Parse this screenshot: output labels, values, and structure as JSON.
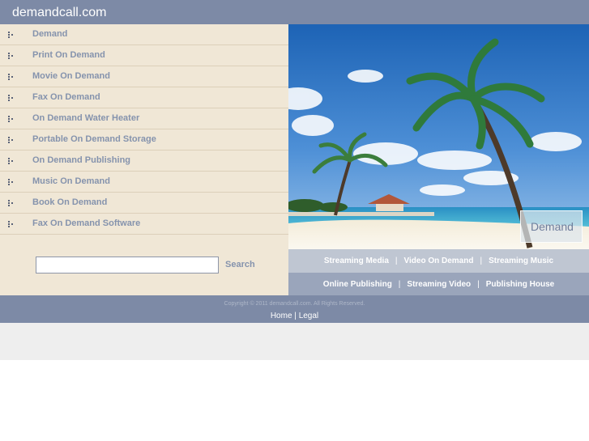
{
  "header": {
    "site_title": "demandcall.com"
  },
  "sidebar": {
    "items": [
      {
        "label": "Demand"
      },
      {
        "label": "Print On Demand"
      },
      {
        "label": "Movie On Demand"
      },
      {
        "label": "Fax On Demand"
      },
      {
        "label": "On Demand Water Heater"
      },
      {
        "label": "Portable On Demand Storage"
      },
      {
        "label": "On Demand Publishing"
      },
      {
        "label": "Music On Demand"
      },
      {
        "label": "Book On Demand"
      },
      {
        "label": "Fax On Demand Software"
      }
    ],
    "item_icon": "bullet-dots-icon"
  },
  "search": {
    "value": "",
    "placeholder": "",
    "button_label": "Search"
  },
  "photo": {
    "badge_label": "Demand"
  },
  "link_rows": [
    [
      "Streaming Media",
      "Video On Demand",
      "Streaming Music"
    ],
    [
      "Online Publishing",
      "Streaming Video",
      "Publishing House"
    ]
  ],
  "link_separator": "|",
  "footer": {
    "copyright": "Copyright © 2011 demandcall.com. All Rights Reserved.",
    "home_label": "Home",
    "separator": "|",
    "legal_label": "Legal"
  },
  "colors": {
    "header_bg": "#7d8aa6",
    "sidebar_bg": "#f0e7d6",
    "link_text": "#8593ad",
    "link_row_1_bg": "#bfc6d2",
    "link_row_2_bg": "#9aa5bb"
  }
}
